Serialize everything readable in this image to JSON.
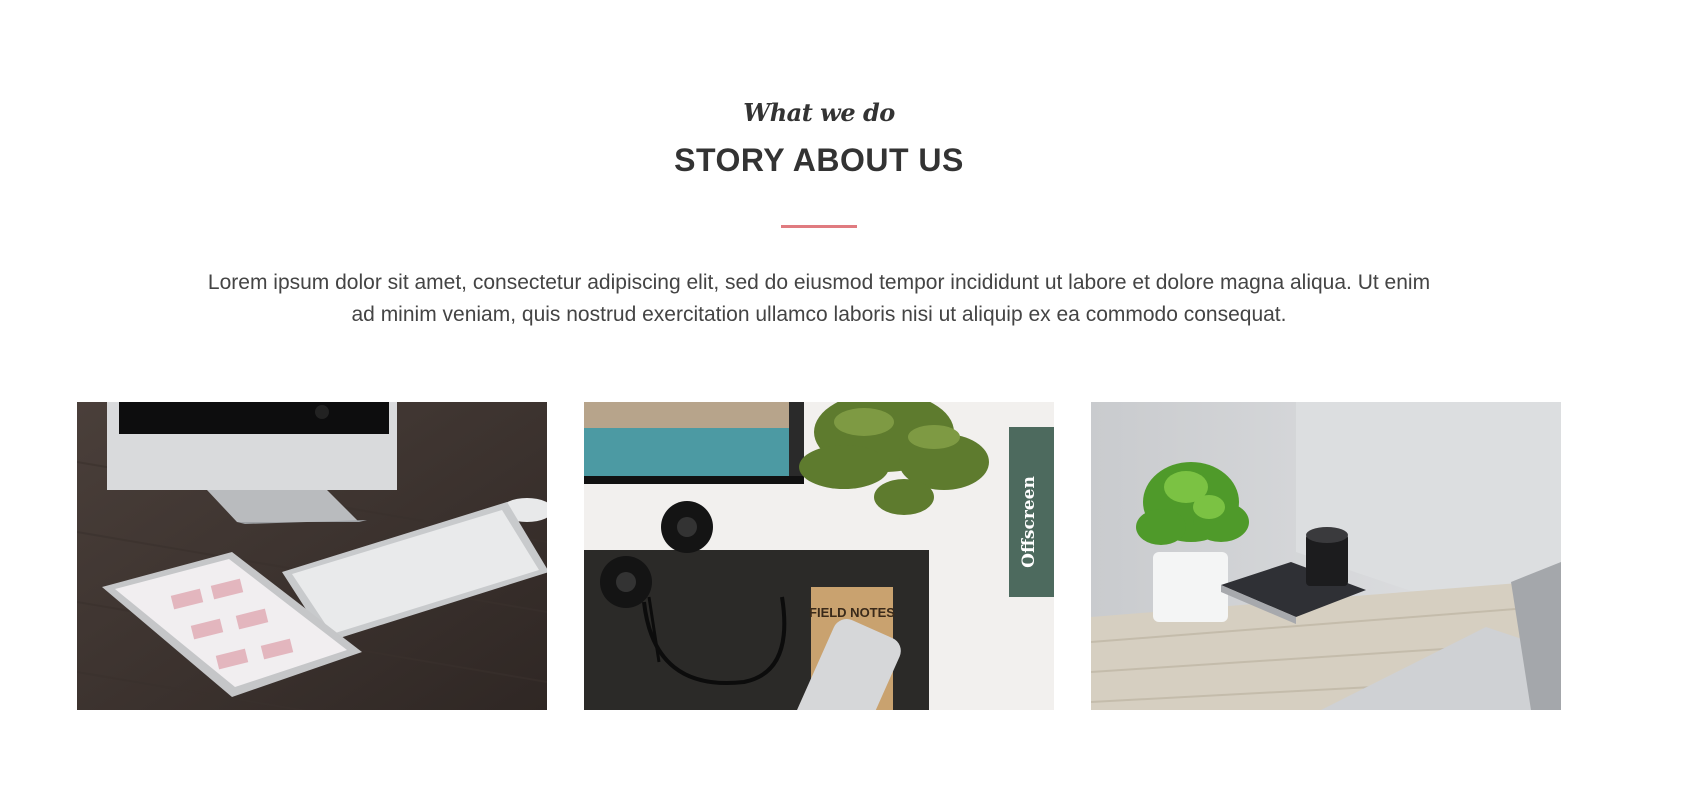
{
  "section": {
    "eyebrow": "What we do",
    "title": "STORY ABOUT US",
    "description": "Lorem ipsum dolor sit amet, consectetur adipiscing elit, sed do eiusmod tempor incididunt ut labore et dolore magna aliqua. Ut enim ad minim veniam, quis nostrud exercitation ullamco laboris nisi ut aliquip ex ea commodo consequat.",
    "accent_color": "#e07b80"
  },
  "gallery": {
    "images": [
      {
        "subject": "imac-keyboard-ipad-desk-photo"
      },
      {
        "subject": "headphones-plant-notebook-phone-photo",
        "notebook_text": "FIELD NOTES",
        "book_spine_text": "Offscreen"
      },
      {
        "subject": "plant-camera-laptop-desk-photo"
      }
    ]
  }
}
